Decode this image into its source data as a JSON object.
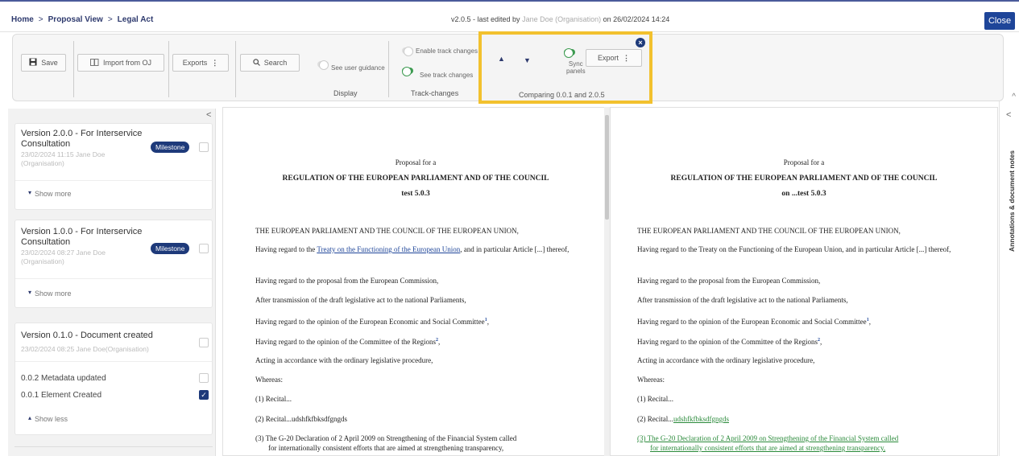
{
  "breadcrumb": {
    "home": "Home",
    "proposal_view": "Proposal View",
    "legal_act": "Legal Act",
    "separator": ">"
  },
  "version_info": {
    "prefix": "v2.0.5 - last edited by",
    "author": "Jane Doe (Organisation)",
    "suffix": "on 26/02/2024 14:24"
  },
  "close_label": "Close",
  "toolbar": {
    "save_label": "Save",
    "import_label": "Import from OJ",
    "exports_label": "Exports",
    "search_label": "Search",
    "user_guidance_label": "See user guidance",
    "display_group_label": "Display",
    "enable_track_changes_label": "Enable track changes",
    "see_track_changes_label": "See track changes",
    "track_changes_group_label": "Track-changes",
    "sync_panels_line1": "Sync",
    "sync_panels_line2": "panels",
    "export_label": "Export",
    "comparing_label": "Comparing 0.0.1 and 2.0.5",
    "kebab": "⋮"
  },
  "versions": [
    {
      "title": "Version 2.0.0 - For Interservice Consultation",
      "meta": "23/02/2024 11:15  Jane Doe (Organisation)",
      "badge": "Milestone",
      "toggle_label": "Show more"
    },
    {
      "title": "Version 1.0.0 - For Interservice Consultation",
      "meta": "23/02/2024 08:27  Jane Doe (Organisation)",
      "badge": "Milestone",
      "toggle_label": "Show more"
    },
    {
      "title": "Version 0.1.0 - Document created",
      "meta": "23/02/2024 08:25  Jane Doe(Organisation)",
      "toggle_label": "Show less",
      "sub_items": [
        {
          "label": "0.0.2  Metadata updated",
          "checked": false
        },
        {
          "label": "0.0.1  Element Created",
          "checked": true
        }
      ]
    }
  ],
  "left_doc": {
    "proposal_for": "Proposal for a",
    "title": "REGULATION OF THE EUROPEAN PARLIAMENT AND OF THE COUNCIL",
    "subtitle": "test 5.0.3",
    "preamble": "THE EUROPEAN PARLIAMENT AND THE COUNCIL OF THE EUROPEAN UNION,",
    "p1_pre": "Having regard to the ",
    "p1_link": "Treaty on the Functioning of the European Union",
    "p1_post": ", and in particular Article [...] thereof,",
    "p2": "Having regard to the proposal from the European Commission,",
    "p3": "After transmission of the draft legislative act to the national Parliaments,",
    "p4": "Having regard to the opinion of the European Economic and Social Committee",
    "p4_sup": "1",
    "p5": "Having regard to the opinion of the Committee of the Regions",
    "p5_sup": "2",
    "p6": "Acting in accordance with the ordinary legislative procedure,",
    "whereas": "Whereas:",
    "r1": "(1)  Recital...",
    "r2": "(2)  Recital...udshfkfbksdfgngds",
    "r3": "(3)  The G-20 Declaration of 2 April 2009 on Strengthening of the Financial System called",
    "r3b": "for internationally consistent efforts that are aimed at strengthening transparency,"
  },
  "right_doc": {
    "proposal_for": "Proposal for a",
    "title": "REGULATION OF THE EUROPEAN PARLIAMENT AND OF THE COUNCIL",
    "subtitle": "on ...test 5.0.3",
    "preamble": "THE EUROPEAN PARLIAMENT AND THE COUNCIL OF THE EUROPEAN UNION,",
    "p1": "Having regard to the Treaty on the Functioning of the European Union, and in particular Article [...] thereof,",
    "p2": "Having regard to the proposal from the European Commission,",
    "p3": "After transmission of the draft legislative act to the national Parliaments,",
    "p4": "Having regard to the opinion of the European Economic and Social Committee",
    "p4_sup": "1",
    "p5": "Having regard to the opinion of the Committee of the Regions",
    "p5_sup": "2",
    "p6": "Acting in accordance with the ordinary legislative procedure,",
    "whereas": "Whereas:",
    "r1": "(1)  Recital...",
    "r2_pre": "(2)  Recital...",
    "r2_added": "udshfkfbksdfgngds",
    "r3": "(3)  The G-20 Declaration of 2 April 2009 on Strengthening of the Financial System called",
    "r3b": "for internationally consistent efforts that are aimed at strengthening transparency,"
  },
  "rail_label": "Annotations & document notes",
  "colors": {
    "accent": "#1e3a7a",
    "highlight": "#f2c12e",
    "added": "#2a8a3a"
  }
}
